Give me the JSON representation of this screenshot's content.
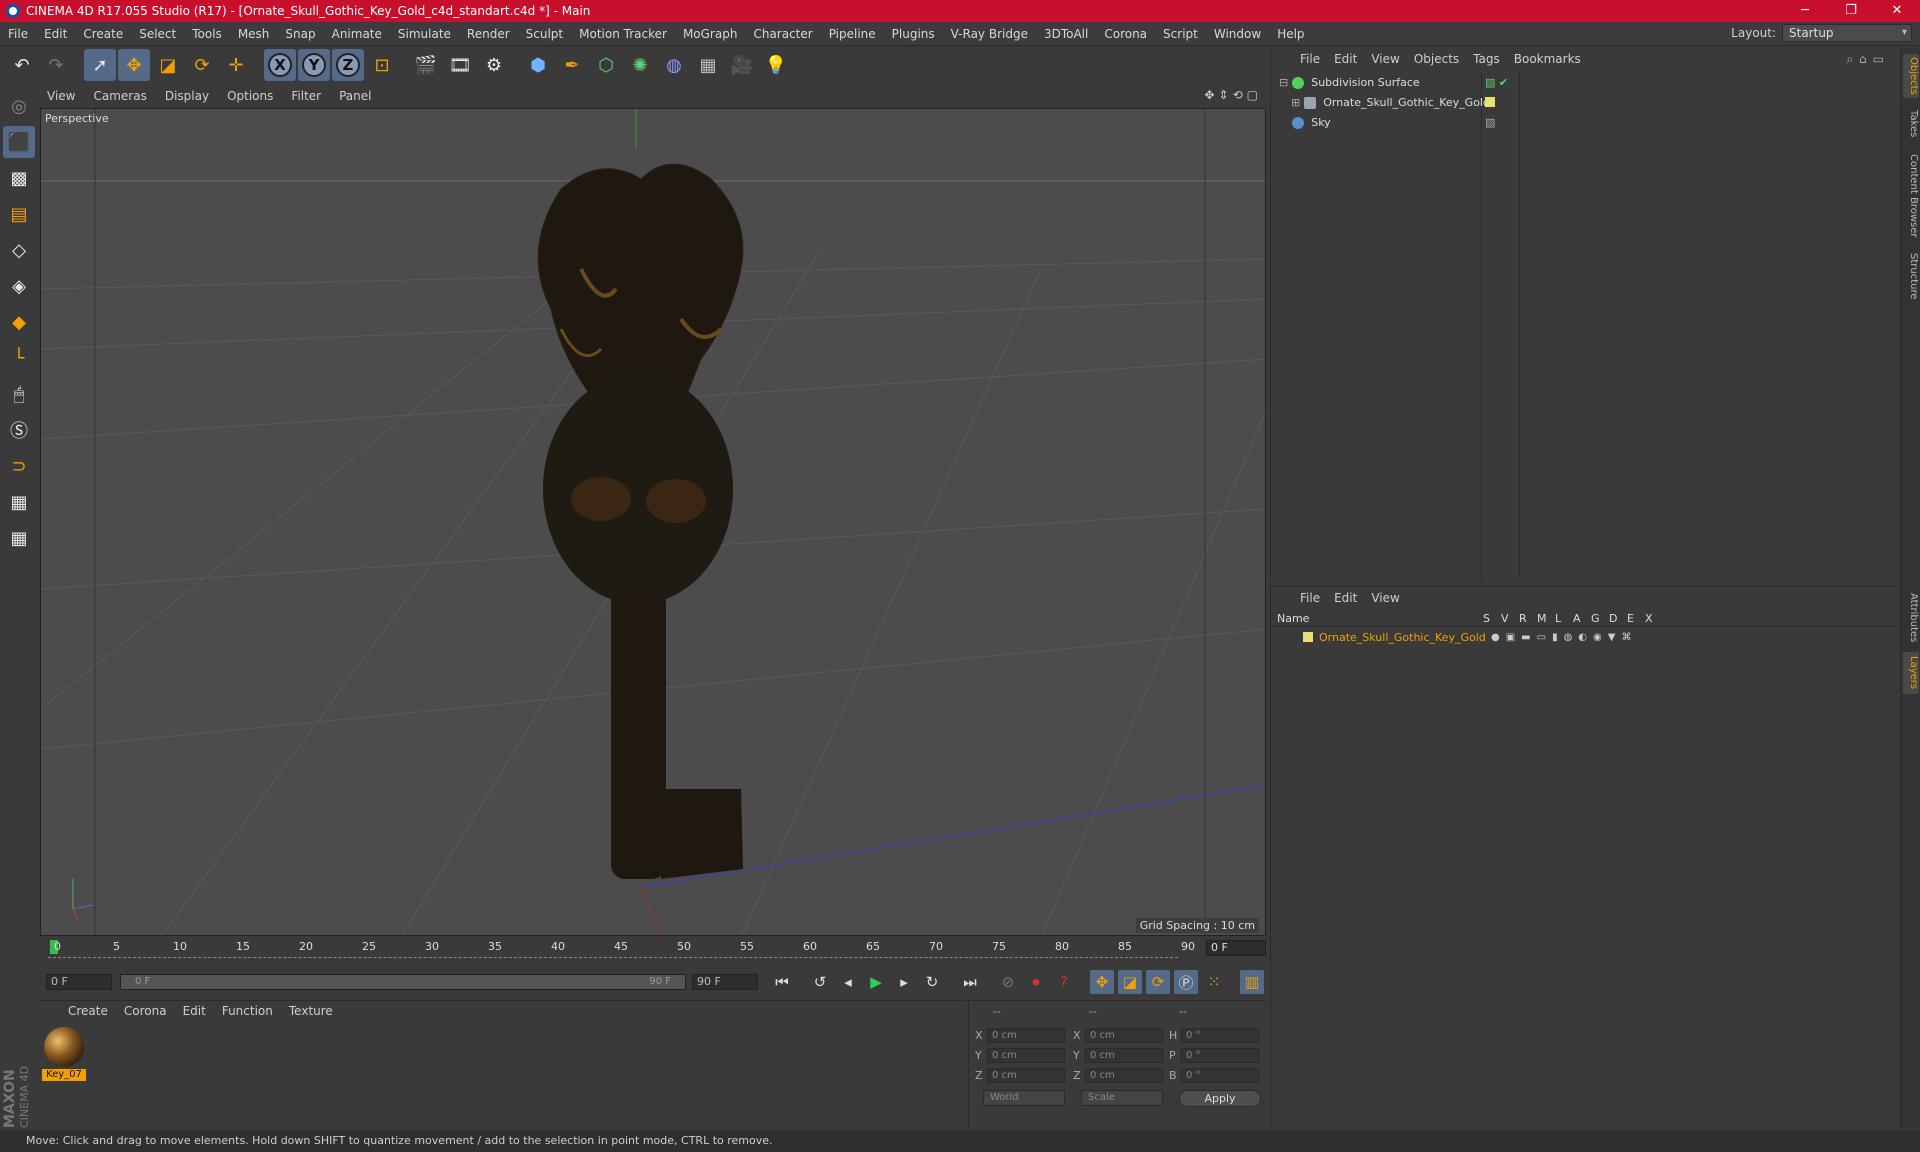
{
  "window": {
    "title": "CINEMA 4D R17.055 Studio (R17) - [Ornate_Skull_Gothic_Key_Gold_c4d_standart.c4d *] - Main",
    "minimize": "─",
    "maximize": "❐",
    "close": "✕"
  },
  "menubar": {
    "items": [
      "File",
      "Edit",
      "Create",
      "Select",
      "Tools",
      "Mesh",
      "Snap",
      "Animate",
      "Simulate",
      "Render",
      "Sculpt",
      "Motion Tracker",
      "MoGraph",
      "Character",
      "Pipeline",
      "Plugins",
      "V-Ray Bridge",
      "3DToAll",
      "Corona",
      "Script",
      "Window",
      "Help"
    ],
    "layout_label": "Layout:",
    "layout_value": "Startup"
  },
  "viewport": {
    "menu": [
      "View",
      "Cameras",
      "Display",
      "Options",
      "Filter",
      "Panel"
    ],
    "label": "Perspective",
    "grid_spacing": "Grid Spacing : 10 cm"
  },
  "timeline": {
    "ticks": [
      "0",
      "5",
      "10",
      "15",
      "20",
      "25",
      "30",
      "35",
      "40",
      "45",
      "50",
      "55",
      "60",
      "65",
      "70",
      "75",
      "80",
      "85",
      "90"
    ],
    "current_frame": "0 F",
    "start_field": "0 F",
    "range_start": "0 F",
    "range_end": "90 F",
    "end_field": "90 F"
  },
  "material_manager": {
    "menu": [
      "Create",
      "Corona",
      "Edit",
      "Function",
      "Texture"
    ],
    "materials": [
      {
        "name": "Key_07"
      }
    ]
  },
  "coordinates": {
    "header": [
      "--",
      "--",
      "--"
    ],
    "rows": [
      {
        "axis1": "X",
        "val1": "0 cm",
        "axis2": "X",
        "val2": "0 cm",
        "axis3": "H",
        "val3": "0 °"
      },
      {
        "axis1": "Y",
        "val1": "0 cm",
        "axis2": "Y",
        "val2": "0 cm",
        "axis3": "P",
        "val3": "0 °"
      },
      {
        "axis1": "Z",
        "val1": "0 cm",
        "axis2": "Z",
        "val2": "0 cm",
        "axis3": "B",
        "val3": "0 °"
      }
    ],
    "mode": "World",
    "type": "Scale",
    "apply": "Apply"
  },
  "object_manager": {
    "menu": [
      "File",
      "Edit",
      "View",
      "Objects",
      "Tags",
      "Bookmarks"
    ],
    "objects": [
      {
        "name": "Subdivision Surface",
        "color": "#4fd35a"
      },
      {
        "name": "Ornate_Skull_Gothic_Key_Gold",
        "color": "#9aa4b4"
      },
      {
        "name": "Sky",
        "color": "#5a8fd0"
      }
    ]
  },
  "layer_manager": {
    "menu": [
      "File",
      "Edit",
      "View"
    ],
    "columns": [
      "Name",
      "S",
      "V",
      "R",
      "M",
      "L",
      "A",
      "G",
      "D",
      "E",
      "X"
    ],
    "layers": [
      {
        "name": "Ornate_Skull_Gothic_Key_Gold",
        "color": "#e8e070"
      }
    ]
  },
  "side_tabs": [
    "Objects",
    "Takes",
    "Content Browser",
    "Structure",
    "Attributes",
    "Layers"
  ],
  "statusbar": {
    "text": "Move: Click and drag to move elements. Hold down SHIFT to quantize movement / add to the selection in point mode, CTRL to remove."
  },
  "logo": {
    "text1": "MAXON",
    "text2": "CINEMA 4D"
  },
  "colors": {
    "accent": "#f0a000",
    "titlebar": "#c8102e",
    "highlight": "#556a88"
  }
}
